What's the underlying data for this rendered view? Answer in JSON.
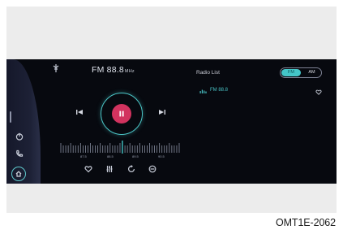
{
  "player": {
    "frequency": "FM 88.8",
    "unit": "MHz",
    "tuner_ticks": [
      "87.5",
      "88.5",
      "89.5",
      "90.5"
    ],
    "tuner_position": 0.52
  },
  "list": {
    "title": "Radio List",
    "band_options": [
      "FM",
      "AM"
    ],
    "selected_band": "FM",
    "stations": [
      {
        "label": "FM 88.8",
        "active": true
      }
    ]
  },
  "colors": {
    "accent": "#44c6c8",
    "play": "#d2335f",
    "screen_bg": "#07090f"
  },
  "caption": "OMT1E-2062"
}
